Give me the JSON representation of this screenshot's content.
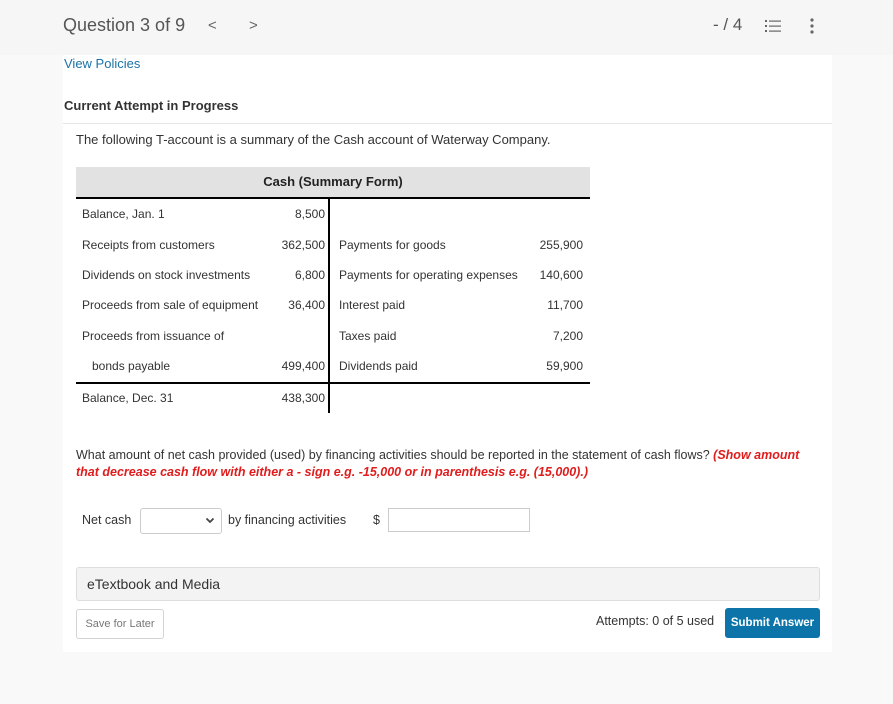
{
  "header": {
    "question_label": "Question 3 of 9",
    "prev_glyph": "<",
    "next_glyph": ">",
    "score": "- / 4",
    "list_icon": "numbered-list-icon",
    "more_icon": "more-vertical-icon"
  },
  "policies_link": "View Policies",
  "attempt_heading": "Current Attempt in Progress",
  "intro_text": "The following T-account is a summary of the Cash account of Waterway Company.",
  "t_account": {
    "title": "Cash (Summary Form)",
    "debits": [
      {
        "label": "Balance, Jan. 1",
        "amount": "8,500"
      },
      {
        "label": "Receipts from customers",
        "amount": "362,500"
      },
      {
        "label": "Dividends on stock investments",
        "amount": "6,800"
      },
      {
        "label": "Proceeds from sale of equipment",
        "amount": "36,400"
      },
      {
        "label": "Proceeds from issuance of",
        "amount": ""
      },
      {
        "label": "bonds payable",
        "amount": "499,400"
      }
    ],
    "credits": [
      {
        "label": "Payments for goods",
        "amount": "255,900"
      },
      {
        "label": "Payments for operating expenses",
        "amount": "140,600"
      },
      {
        "label": "Interest paid",
        "amount": "11,700"
      },
      {
        "label": "Taxes paid",
        "amount": "7,200"
      },
      {
        "label": "Dividends paid",
        "amount": "59,900"
      }
    ],
    "ending": {
      "label": "Balance, Dec. 31",
      "amount": "438,300"
    }
  },
  "question": {
    "text": "What amount of net cash provided (used) by financing activities should be reported in the statement of cash flows? ",
    "hint": "(Show amount that decrease cash flow with either a - sign e.g. -15,000 or in parenthesis e.g. (15,000).)"
  },
  "answer": {
    "net_cash_label": "Net cash",
    "select_value": "",
    "by_label": "by financing activities",
    "currency": "$",
    "amount_value": "",
    "amount_placeholder": ""
  },
  "etextbook_label": "eTextbook and Media",
  "footer": {
    "save_label": "Save for Later",
    "attempts_text": "Attempts: 0 of 5 used",
    "submit_label": "Submit Answer"
  },
  "colors": {
    "link": "#1a73a8",
    "hint": "#e01c1c",
    "submit_bg": "#0c74a8"
  }
}
